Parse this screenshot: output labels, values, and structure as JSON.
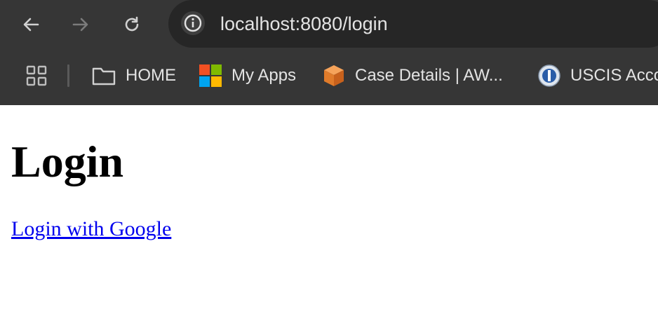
{
  "browser": {
    "url_host": "localhost",
    "url_rest": ":8080/login",
    "bookmarks": [
      {
        "label": "HOME",
        "icon": "folder-icon"
      },
      {
        "label": "My Apps",
        "icon": "microsoft-logo-icon"
      },
      {
        "label": "Case Details | AW...",
        "icon": "aws-box-icon"
      },
      {
        "label": "USCIS Acco",
        "icon": "uscis-seal-icon"
      }
    ]
  },
  "page": {
    "title": "Login",
    "google_link": "Login with Google"
  },
  "colors": {
    "chrome_bg": "#363636",
    "omnibox_bg": "#262626",
    "link": "#0000ee"
  }
}
